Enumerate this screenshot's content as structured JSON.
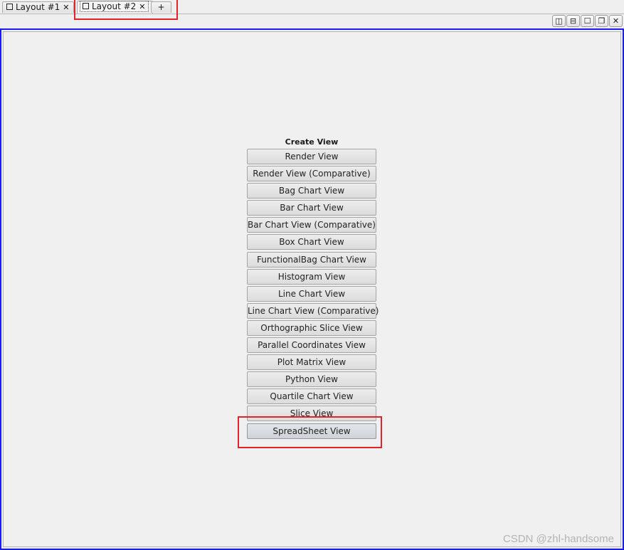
{
  "tabs": [
    {
      "label": "Layout #1",
      "icon": "layout-square-icon",
      "close": "✕",
      "active": false
    },
    {
      "label": "Layout #2",
      "icon": "layout-square-icon",
      "close": "✕",
      "active": true
    }
  ],
  "new_tab_label": "+",
  "window_buttons": [
    {
      "name": "split-horizontal-button",
      "icon": "split-horizontal-icon",
      "glyph": "◫"
    },
    {
      "name": "split-vertical-button",
      "icon": "split-vertical-icon",
      "glyph": "⊟"
    },
    {
      "name": "maximize-button",
      "icon": "maximize-icon",
      "glyph": "☐"
    },
    {
      "name": "restore-button",
      "icon": "restore-icon",
      "glyph": "❐"
    },
    {
      "name": "close-button",
      "icon": "close-icon",
      "glyph": "✕"
    }
  ],
  "create_view": {
    "title": "Create View",
    "buttons": [
      "Render View",
      "Render View (Comparative)",
      "Bag Chart View",
      "Bar Chart View",
      "Bar Chart View (Comparative)",
      "Box Chart View",
      "FunctionalBag Chart View",
      "Histogram View",
      "Line Chart View",
      "Line Chart View (Comparative)",
      "Orthographic Slice View",
      "Parallel Coordinates View",
      "Plot Matrix View",
      "Python View",
      "Quartile Chart View",
      "Slice View",
      "SpreadSheet View"
    ]
  },
  "annotation_color": "#e2232b",
  "frame_color": "#1a1aff",
  "watermark": "CSDN @zhl-handsome"
}
